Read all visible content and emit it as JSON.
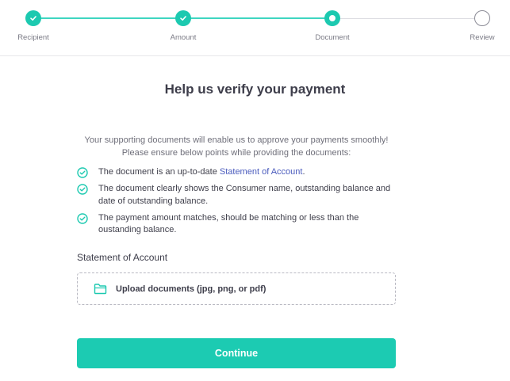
{
  "stepper": {
    "steps": [
      {
        "label": "Recipient",
        "state": "done"
      },
      {
        "label": "Amount",
        "state": "done"
      },
      {
        "label": "Document",
        "state": "active"
      },
      {
        "label": "Review",
        "state": "todo"
      }
    ]
  },
  "main": {
    "title": "Help us verify your payment",
    "intro_line1": "Your supporting documents will enable us to approve your payments smoothly!",
    "intro_line2": "Please ensure below points while providing the documents:",
    "checklist": [
      {
        "prefix": "The document is an up-to-date ",
        "link": "Statement of Account",
        "suffix": "."
      },
      {
        "text": "The document clearly shows the Consumer name, outstanding balance and date of outstanding balance."
      },
      {
        "text": "The payment amount matches, should be matching or less than the oustanding balance."
      }
    ],
    "section_label": "Statement of Account",
    "upload_label": "Upload documents (jpg, png, or pdf)",
    "continue_label": "Continue"
  },
  "colors": {
    "accent": "#1ccbb2",
    "link": "#4a5bbd"
  },
  "icons": {
    "step_done": "check-icon",
    "checklist": "check-circle-icon",
    "upload": "folder-icon"
  }
}
